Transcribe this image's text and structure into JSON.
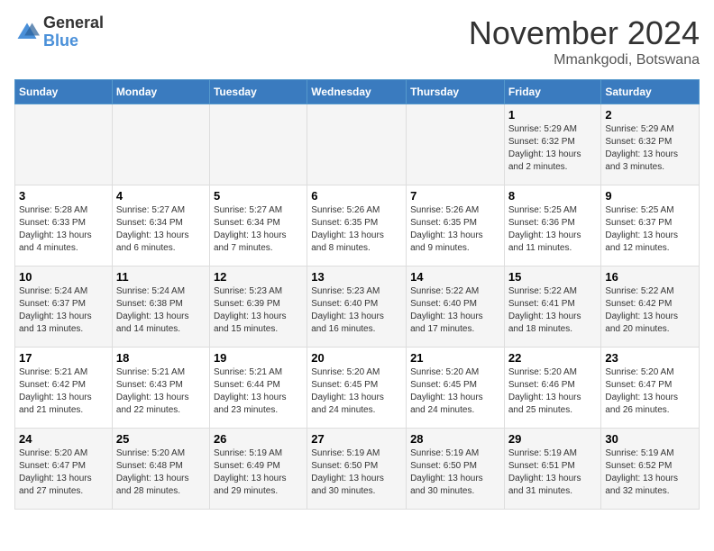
{
  "logo": {
    "text_general": "General",
    "text_blue": "Blue"
  },
  "header": {
    "month": "November 2024",
    "location": "Mmankgodi, Botswana"
  },
  "weekdays": [
    "Sunday",
    "Monday",
    "Tuesday",
    "Wednesday",
    "Thursday",
    "Friday",
    "Saturday"
  ],
  "weeks": [
    [
      {
        "day": "",
        "info": ""
      },
      {
        "day": "",
        "info": ""
      },
      {
        "day": "",
        "info": ""
      },
      {
        "day": "",
        "info": ""
      },
      {
        "day": "",
        "info": ""
      },
      {
        "day": "1",
        "info": "Sunrise: 5:29 AM\nSunset: 6:32 PM\nDaylight: 13 hours\nand 2 minutes."
      },
      {
        "day": "2",
        "info": "Sunrise: 5:29 AM\nSunset: 6:32 PM\nDaylight: 13 hours\nand 3 minutes."
      }
    ],
    [
      {
        "day": "3",
        "info": "Sunrise: 5:28 AM\nSunset: 6:33 PM\nDaylight: 13 hours\nand 4 minutes."
      },
      {
        "day": "4",
        "info": "Sunrise: 5:27 AM\nSunset: 6:34 PM\nDaylight: 13 hours\nand 6 minutes."
      },
      {
        "day": "5",
        "info": "Sunrise: 5:27 AM\nSunset: 6:34 PM\nDaylight: 13 hours\nand 7 minutes."
      },
      {
        "day": "6",
        "info": "Sunrise: 5:26 AM\nSunset: 6:35 PM\nDaylight: 13 hours\nand 8 minutes."
      },
      {
        "day": "7",
        "info": "Sunrise: 5:26 AM\nSunset: 6:35 PM\nDaylight: 13 hours\nand 9 minutes."
      },
      {
        "day": "8",
        "info": "Sunrise: 5:25 AM\nSunset: 6:36 PM\nDaylight: 13 hours\nand 11 minutes."
      },
      {
        "day": "9",
        "info": "Sunrise: 5:25 AM\nSunset: 6:37 PM\nDaylight: 13 hours\nand 12 minutes."
      }
    ],
    [
      {
        "day": "10",
        "info": "Sunrise: 5:24 AM\nSunset: 6:37 PM\nDaylight: 13 hours\nand 13 minutes."
      },
      {
        "day": "11",
        "info": "Sunrise: 5:24 AM\nSunset: 6:38 PM\nDaylight: 13 hours\nand 14 minutes."
      },
      {
        "day": "12",
        "info": "Sunrise: 5:23 AM\nSunset: 6:39 PM\nDaylight: 13 hours\nand 15 minutes."
      },
      {
        "day": "13",
        "info": "Sunrise: 5:23 AM\nSunset: 6:40 PM\nDaylight: 13 hours\nand 16 minutes."
      },
      {
        "day": "14",
        "info": "Sunrise: 5:22 AM\nSunset: 6:40 PM\nDaylight: 13 hours\nand 17 minutes."
      },
      {
        "day": "15",
        "info": "Sunrise: 5:22 AM\nSunset: 6:41 PM\nDaylight: 13 hours\nand 18 minutes."
      },
      {
        "day": "16",
        "info": "Sunrise: 5:22 AM\nSunset: 6:42 PM\nDaylight: 13 hours\nand 20 minutes."
      }
    ],
    [
      {
        "day": "17",
        "info": "Sunrise: 5:21 AM\nSunset: 6:42 PM\nDaylight: 13 hours\nand 21 minutes."
      },
      {
        "day": "18",
        "info": "Sunrise: 5:21 AM\nSunset: 6:43 PM\nDaylight: 13 hours\nand 22 minutes."
      },
      {
        "day": "19",
        "info": "Sunrise: 5:21 AM\nSunset: 6:44 PM\nDaylight: 13 hours\nand 23 minutes."
      },
      {
        "day": "20",
        "info": "Sunrise: 5:20 AM\nSunset: 6:45 PM\nDaylight: 13 hours\nand 24 minutes."
      },
      {
        "day": "21",
        "info": "Sunrise: 5:20 AM\nSunset: 6:45 PM\nDaylight: 13 hours\nand 24 minutes."
      },
      {
        "day": "22",
        "info": "Sunrise: 5:20 AM\nSunset: 6:46 PM\nDaylight: 13 hours\nand 25 minutes."
      },
      {
        "day": "23",
        "info": "Sunrise: 5:20 AM\nSunset: 6:47 PM\nDaylight: 13 hours\nand 26 minutes."
      }
    ],
    [
      {
        "day": "24",
        "info": "Sunrise: 5:20 AM\nSunset: 6:47 PM\nDaylight: 13 hours\nand 27 minutes."
      },
      {
        "day": "25",
        "info": "Sunrise: 5:20 AM\nSunset: 6:48 PM\nDaylight: 13 hours\nand 28 minutes."
      },
      {
        "day": "26",
        "info": "Sunrise: 5:19 AM\nSunset: 6:49 PM\nDaylight: 13 hours\nand 29 minutes."
      },
      {
        "day": "27",
        "info": "Sunrise: 5:19 AM\nSunset: 6:50 PM\nDaylight: 13 hours\nand 30 minutes."
      },
      {
        "day": "28",
        "info": "Sunrise: 5:19 AM\nSunset: 6:50 PM\nDaylight: 13 hours\nand 30 minutes."
      },
      {
        "day": "29",
        "info": "Sunrise: 5:19 AM\nSunset: 6:51 PM\nDaylight: 13 hours\nand 31 minutes."
      },
      {
        "day": "30",
        "info": "Sunrise: 5:19 AM\nSunset: 6:52 PM\nDaylight: 13 hours\nand 32 minutes."
      }
    ]
  ]
}
